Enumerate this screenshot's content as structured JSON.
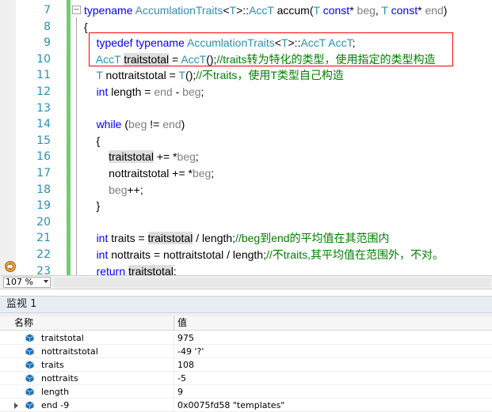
{
  "editor": {
    "lines": [
      {
        "num": "7",
        "html": "<span class=\"kw\">typename</span> <span class=\"ty\">AccumlationTraits</span>&lt;<span class=\"ty\">T</span>&gt;::<span class=\"ty\">AccT</span> accum(<span class=\"ty\">T</span> <span class=\"kw\">const</span>* <span class=\"pr\">beg</span>, <span class=\"ty\">T</span> <span class=\"kw\">const</span>* <span class=\"pr\">end</span>)"
      },
      {
        "num": "8",
        "html": "{"
      },
      {
        "num": "9",
        "html": "    <span class=\"kw\">typedef</span> <span class=\"kw\">typename</span> <span class=\"ty\">AccumlationTraits</span>&lt;<span class=\"ty\">T</span>&gt;::<span class=\"ty\">AccT</span> <span class=\"ty\">AccT</span>;"
      },
      {
        "num": "10",
        "html": "    <span class=\"ty\">AccT</span> <span class=\"hl\">traitstotal</span> = <span class=\"ty\">AccT</span>();<span class=\"cm\">//traits转为特化的类型，使用指定的类型构造</span>"
      },
      {
        "num": "11",
        "html": "    <span class=\"ty\">T</span> nottraitstotal = <span class=\"ty\">T</span>();<span class=\"cm\">//不traits，使用T类型自己构造</span>"
      },
      {
        "num": "12",
        "html": "    <span class=\"kw\">int</span> length = <span class=\"pr\">end</span> - <span class=\"pr\">beg</span>;"
      },
      {
        "num": "13",
        "html": ""
      },
      {
        "num": "14",
        "html": "    <span class=\"kw\">while</span> (<span class=\"pr\">beg</span> != <span class=\"pr\">end</span>)"
      },
      {
        "num": "15",
        "html": "    {"
      },
      {
        "num": "16",
        "html": "        <span class=\"hl\">traitstotal</span> += *<span class=\"pr\">beg</span>;"
      },
      {
        "num": "17",
        "html": "        nottraitstotal += *<span class=\"pr\">beg</span>;"
      },
      {
        "num": "18",
        "html": "        <span class=\"pr\">beg</span>++;"
      },
      {
        "num": "19",
        "html": "    }"
      },
      {
        "num": "20",
        "html": ""
      },
      {
        "num": "21",
        "html": "    <span class=\"kw\">int</span> traits = <span class=\"hl\">traitstotal</span> / length;<span class=\"cm\">//beg到end的平均值在其范围内</span>"
      },
      {
        "num": "22",
        "html": "    <span class=\"kw\">int</span> nottraits = nottraitstotal / length;<span class=\"cm\">//不traits,其平均值在范围外，不对。</span>"
      },
      {
        "num": "23",
        "html": "    <span class=\"kw\">return</span> <span class=\"hl\">traitstotal</span>;"
      }
    ]
  },
  "zoom": {
    "value": "107 %"
  },
  "watch": {
    "title": "监视 1",
    "col_name": "名称",
    "col_value": "值",
    "rows": [
      {
        "name": "traitstotal",
        "value": "975"
      },
      {
        "name": "nottraitstotal",
        "value": "-49 '?'"
      },
      {
        "name": "traits",
        "value": "108"
      },
      {
        "name": "nottraits",
        "value": "-5"
      },
      {
        "name": "length",
        "value": "9"
      },
      {
        "name": "end -9",
        "value": "0x0075fd58 \"templates\"",
        "expandable": true
      }
    ]
  },
  "colors": {
    "keyword": "#0000ff",
    "type": "#2b91af",
    "comment": "#008000",
    "highlight_box": "#ff0000",
    "change_bar": "#6ccf6c"
  }
}
